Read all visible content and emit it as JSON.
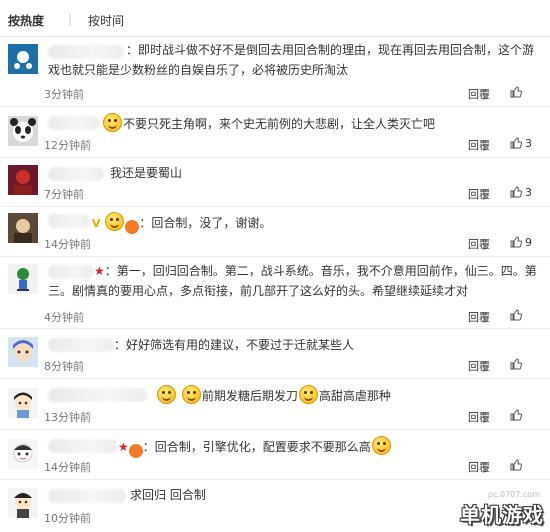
{
  "sort": {
    "hot": "按热度",
    "sep": "|",
    "time": "按时间"
  },
  "comments": [
    {
      "text": "：即时战斗做不好不是倒回去用回合制的理由，现在再回去用回合制，这个游戏也就只能是少数粉丝的自娱自乐了，必将被历史所淘汰",
      "time": "3分钟前",
      "reply": "回覆",
      "likes": ""
    },
    {
      "text": "不要只死主角啊，来个史无前例的大悲剧，让全人类灭亡吧",
      "time": "12分钟前",
      "reply": "回覆",
      "likes": "3"
    },
    {
      "text": "我还是要蜀山",
      "time": "7分钟前",
      "reply": "回覆",
      "likes": "3"
    },
    {
      "text": "：回合制，没了，谢谢。",
      "time": "14分钟前",
      "reply": "回覆",
      "likes": "9"
    },
    {
      "text": "：第一，回归回合制。第二，战斗系统。音乐，我不介意用回前作，仙三。四。第三。剧情真的要用心点，多点衔接，前几部开了这么好的头。希望继续延续才对",
      "time": "4分钟前",
      "reply": "回覆",
      "likes": ""
    },
    {
      "text": "：好好筛选有用的建议，不要过于迁就某些人",
      "time": "8分钟前",
      "reply": "回覆",
      "likes": ""
    },
    {
      "text_a": "前期发糖后期发刀",
      "text_b": "高甜高虐那种",
      "time": "13分钟前",
      "reply": "回覆",
      "likes": ""
    },
    {
      "text": "：回合制，引擎优化，配置要求不要那么高",
      "time": "14分钟前",
      "reply": "回覆",
      "likes": ""
    },
    {
      "text": "求回归 回合制",
      "time": "10分钟前",
      "reply": "",
      "likes": ""
    }
  ],
  "badges": {
    "v": "V",
    "lv": "红"
  },
  "watermark": {
    "site": "pc.0707.com",
    "logo": "单机游戏"
  },
  "colors": {
    "text": "#333333",
    "meta": "#777777",
    "divider": "#eeeeee",
    "accent": "#f07b2a"
  },
  "icons": {
    "like": "thumbs-up-icon",
    "emoji": "smiley-face-icon"
  }
}
